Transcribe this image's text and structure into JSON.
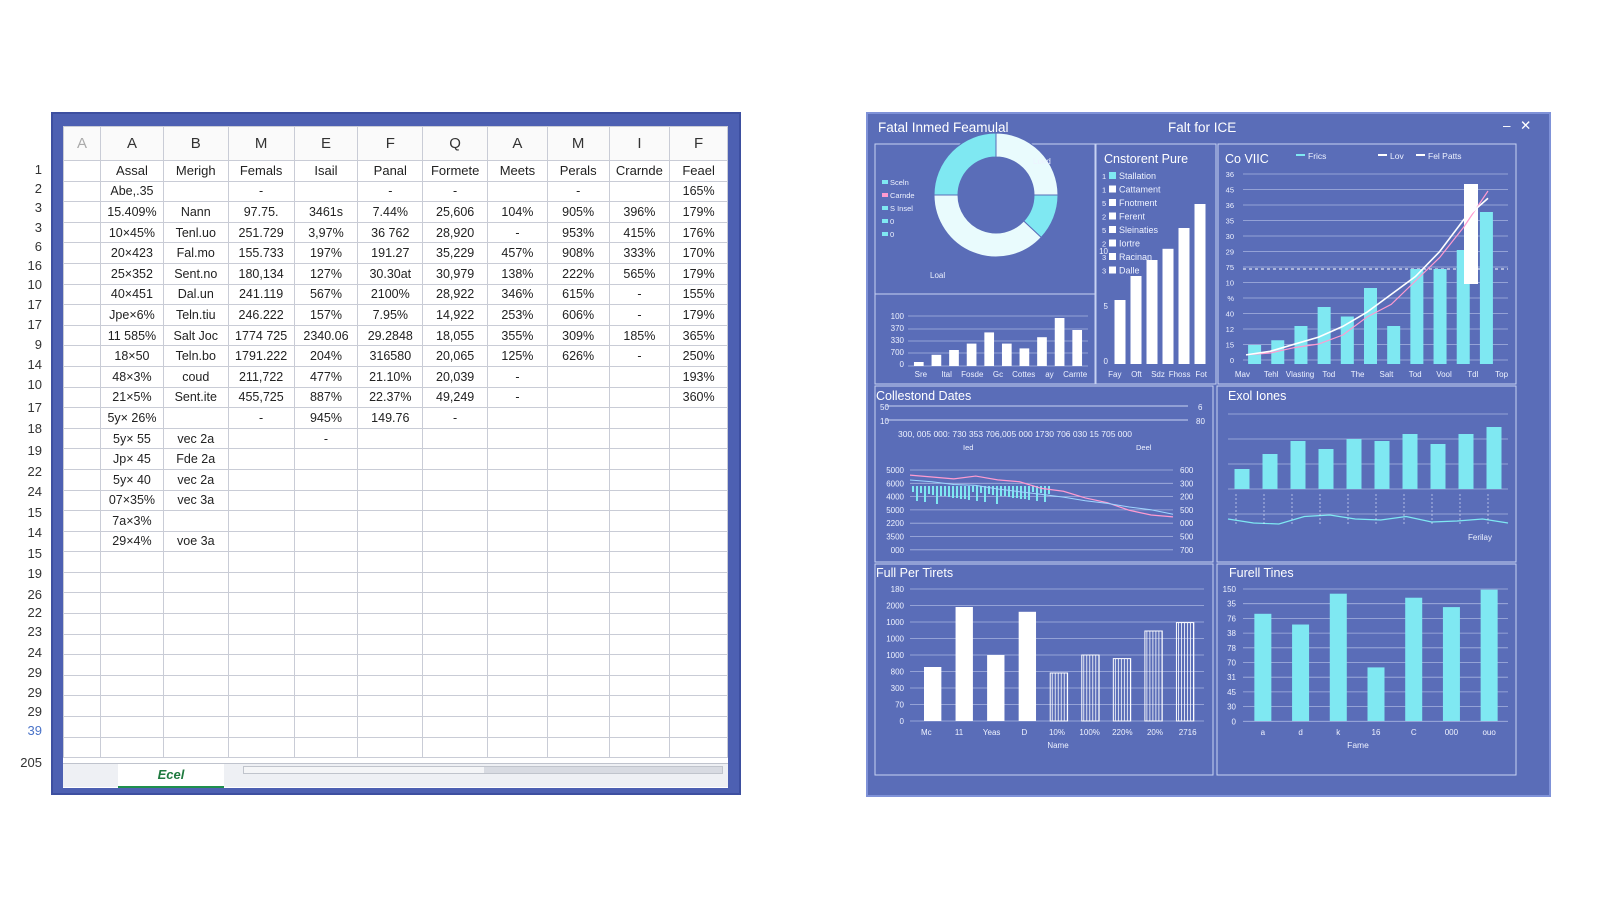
{
  "spreadsheet": {
    "row_numbers": [
      "1",
      "2",
      "3",
      "3",
      "6",
      "16",
      "10",
      "17",
      "17",
      "9",
      "14",
      "10",
      "17",
      "18",
      "19",
      "22",
      "24",
      "15",
      "14",
      "15",
      "19",
      "26",
      "22",
      "23",
      "24",
      "29",
      "29",
      "29",
      "39",
      "205"
    ],
    "column_letters": [
      "A",
      "A",
      "B",
      "M",
      "E",
      "F",
      "Q",
      "A",
      "M",
      "I",
      "F"
    ],
    "column_names": [
      "",
      "Assal",
      "Merigh",
      "Femals",
      "Isail",
      "Panal",
      "Formete",
      "Meets",
      "Perals",
      "Crarnde",
      "Feael"
    ],
    "rows": [
      [
        "",
        "Abe,.35",
        "",
        "-",
        "",
        "-",
        "-",
        "",
        "-",
        "",
        "165%"
      ],
      [
        "",
        "15.409%",
        "Nann",
        "97.75.",
        "3461s",
        "7.44%",
        "25,606",
        "104%",
        "905%",
        "396%",
        "179%"
      ],
      [
        "",
        "10×45%",
        "Tenl.uo",
        "251.729",
        "3,97%",
        "36 762",
        "28,920",
        "-",
        "953%",
        "415%",
        "176%"
      ],
      [
        "",
        "20×423",
        "Fal.mo",
        "155.733",
        "197%",
        "191.27",
        "35,229",
        "457%",
        "908%",
        "333%",
        "170%"
      ],
      [
        "",
        "25×352",
        "Sent.no",
        "180,134",
        "127%",
        "30.30at",
        "30,979",
        "138%",
        "222%",
        "565%",
        "179%"
      ],
      [
        "",
        "40×451",
        "Dal.un",
        "241.119",
        "567%",
        "2100%",
        "28,922",
        "346%",
        "615%",
        "-",
        "155%"
      ],
      [
        "",
        "Jpe×6%",
        "Teln.tiu",
        "246.222",
        "157%",
        "7.95%",
        "14,922",
        "253%",
        "606%",
        "-",
        "179%"
      ],
      [
        "",
        "11 585%",
        "Salt Joc",
        "1774 725",
        "2340.06",
        "29.2848",
        "18,055",
        "355%",
        "309%",
        "185%",
        "365%"
      ],
      [
        "",
        "18×50",
        "Teln.bo",
        "1791.222",
        "204%",
        "316580",
        "20,065",
        "125%",
        "626%",
        "-",
        "250%"
      ],
      [
        "",
        "48×3%",
        "coud",
        "211,722",
        "477%",
        "21.10%",
        "20,039",
        "-",
        "",
        "",
        "193%"
      ],
      [
        "",
        "21×5%",
        "Sent.ite",
        "455,725",
        "887%",
        "22.37%",
        "49,249",
        "-",
        "",
        "",
        "360%"
      ],
      [
        "",
        "5y× 26%",
        "",
        "-",
        "945%",
        "149.76",
        "-",
        "",
        "",
        "",
        ""
      ],
      [
        "",
        "5y× 55",
        "vec 2a",
        "",
        "-",
        "",
        "",
        "",
        "",
        "",
        ""
      ],
      [
        "",
        "Jp× 45",
        "Fde 2a",
        "",
        "",
        "",
        "",
        "",
        "",
        "",
        ""
      ],
      [
        "",
        "5y× 40",
        "vec 2a",
        "",
        "",
        "",
        "",
        "",
        "",
        "",
        ""
      ],
      [
        "",
        "07×35%",
        "vec 3a",
        "",
        "",
        "",
        "",
        "",
        "",
        "",
        ""
      ],
      [
        "",
        "7a×3%",
        "",
        "",
        "",
        "",
        "",
        "",
        "",
        "",
        ""
      ],
      [
        "",
        "29×4%",
        "voe 3a",
        "",
        "",
        "",
        "",
        "",
        "",
        "",
        ""
      ]
    ],
    "sheet_tab": "Ecel"
  },
  "dashboard": {
    "title_left": "Fatal Inmed Feamulal",
    "title_center": "Falt for ICE",
    "min_icon": "minimize-icon",
    "close_icon": "close-icon",
    "accent": "#7fe8f2",
    "background": "#5a6db8",
    "donut_panel": {
      "legend": [
        "Sceln",
        "Carnde",
        "S Insel",
        "0",
        "0"
      ],
      "label_top": "Loed",
      "label_bottom": "Loal",
      "chart_data": {
        "type": "pie",
        "values": [
          25,
          12,
          38,
          25
        ]
      }
    },
    "small_bars": {
      "y_ticks": [
        "100",
        "370",
        "330",
        "700",
        "0"
      ],
      "x_labels": [
        "Sre",
        "Ital",
        "Fosde",
        "Gc",
        "Cottes",
        "ay",
        "Carnte"
      ],
      "chart_data": {
        "type": "bar",
        "values": [
          5,
          14,
          20,
          28,
          42,
          28,
          22,
          36,
          60,
          45
        ]
      }
    },
    "constant_panel": {
      "title": "Cnstorent Pure",
      "legend": [
        "Stallation",
        "Cattament",
        "Fnotment",
        "Ferent",
        "Sleinaties",
        "Iortre",
        "Racinan",
        "Dalle"
      ],
      "legend_nums": [
        "1",
        "1",
        "5",
        "2",
        "5",
        "2",
        "3",
        "3"
      ],
      "y_ticks": [
        "10",
        "5",
        "0"
      ],
      "x_labels": [
        "Fay",
        "Oft",
        "Sdz",
        "Fhoss",
        "Fot"
      ],
      "chart_data": {
        "type": "bar",
        "values": [
          40,
          55,
          65,
          72,
          85,
          100
        ]
      }
    },
    "line_panel": {
      "title": "Co VIIC",
      "legend": [
        "Frics",
        "Lov",
        "Fel Patts"
      ],
      "y_ticks": [
        "36",
        "45",
        "36",
        "35",
        "30",
        "29",
        "75",
        "10",
        "%",
        "40",
        "12",
        "15",
        "0"
      ],
      "x_labels": [
        "Mav",
        "Tehl",
        "Vlasting",
        "Tod",
        "The",
        "Salt",
        "Tod",
        "Vool",
        "Tdl",
        "Top"
      ],
      "chart_data": {
        "type": "line",
        "series": [
          {
            "name": "Frics",
            "values": [
              4,
              5,
              8,
              12,
              10,
              16,
              8,
              20,
              20,
              24,
              32
            ]
          },
          {
            "name": "Lov",
            "values": [
              4,
              5,
              8,
              10,
              15,
              25,
              32,
              45,
              58,
              75,
              95
            ]
          },
          {
            "name": "Fel Patts",
            "values": [
              4,
              6,
              10,
              14,
              20,
              28,
              38,
              48,
              62,
              80,
              92
            ]
          }
        ]
      }
    },
    "collected_panel": {
      "title": "Collestond Dates",
      "top_ticks": "300, 005 000: 730 353 706,005 000 1730 706 030 15 705 000",
      "top_left": [
        "50",
        "10"
      ],
      "top_right": [
        "6",
        "80"
      ],
      "top_sub": [
        "Ied",
        "Deel"
      ],
      "y_left": [
        "5000",
        "6000",
        "4000",
        "5000",
        "2200",
        "3500",
        "000"
      ],
      "y_right": [
        "600",
        "300",
        "200",
        "500",
        "000",
        "500",
        "700"
      ],
      "chart_data": {
        "type": "line",
        "series": [
          {
            "name": "",
            "values": [
              62,
              60,
              58,
              61,
              57,
              55,
              48,
              45,
              38,
              33,
              25,
              20,
              18
            ]
          },
          {
            "name": "",
            "values": [
              60,
              58,
              55,
              54,
              50,
              47,
              44,
              41,
              37,
              34,
              30,
              27,
              22
            ]
          }
        ]
      }
    },
    "excel_panel": {
      "title": "Exol Iones",
      "x_label": "Ferilay",
      "chart_data": {
        "type": "bar",
        "values": [
          20,
          35,
          48,
          40,
          50,
          48,
          55,
          45,
          55,
          62
        ]
      }
    },
    "full_panel": {
      "title": "Full Per Tirets",
      "y_ticks": [
        "180",
        "2000",
        "1000",
        "1000",
        "1000",
        "800",
        "300",
        "70",
        "0"
      ],
      "x_labels": [
        "Mc",
        "11",
        "Yeas",
        "D",
        "10%",
        "100%",
        "220%",
        "20%",
        "2716"
      ],
      "x_title": "Name",
      "chart_data": {
        "type": "bar",
        "values": [
          45,
          95,
          55,
          91,
          40,
          55,
          52,
          75,
          82
        ]
      }
    },
    "fuel_panel": {
      "title": "Furell Tines",
      "y_ticks": [
        "150",
        "35",
        "76",
        "38",
        "78",
        "70",
        "31",
        "45",
        "30",
        "0"
      ],
      "x_labels": [
        "a",
        "d",
        "k",
        "16",
        "C",
        "000",
        "ouo"
      ],
      "x_title": "Fame",
      "chart_data": {
        "type": "bar",
        "values": [
          80,
          72,
          95,
          40,
          92,
          85,
          98
        ]
      }
    }
  }
}
